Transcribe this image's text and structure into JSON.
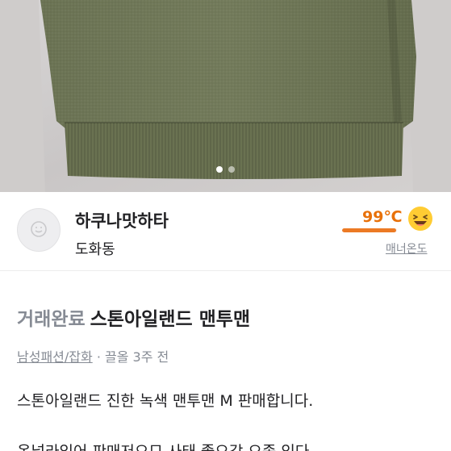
{
  "photo": {
    "alt": "product-photo",
    "slide_count": 2,
    "active_slide": 1
  },
  "seller": {
    "name": "하쿠나맛하타",
    "location": "도화동",
    "temperature": "99℃",
    "temperature_level": 0.99,
    "manner_label": "매너온도",
    "accent_color": "#e8710a"
  },
  "article": {
    "status": "거래완료",
    "title": "스톤아일랜드 맨투맨",
    "category": "남성패션/잡화",
    "separator": "·",
    "bump_time": "끌올 3주 전",
    "description": "스톤아일랜드 진한 녹색 맨투맨 M 판매합니다.",
    "description_cut": "옷넣라입어 판매저으므 사태 좋으각 으좀 있다"
  }
}
